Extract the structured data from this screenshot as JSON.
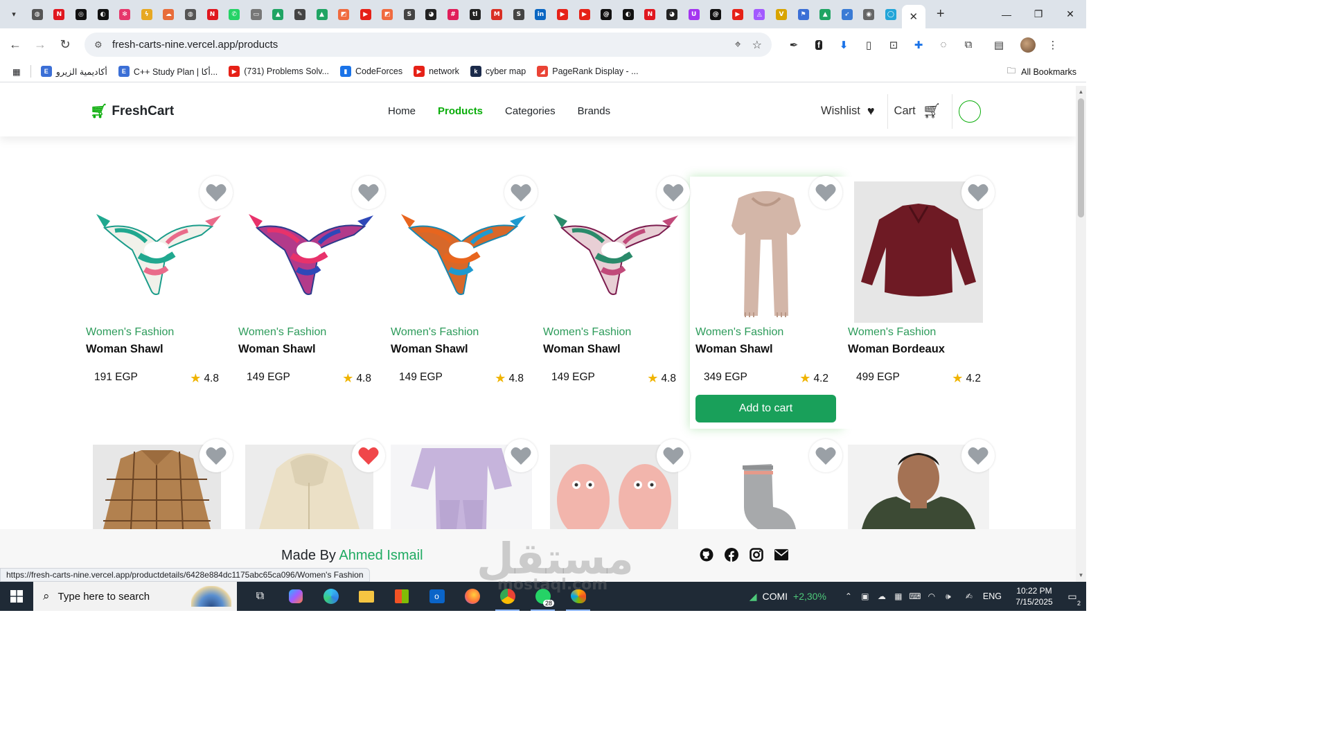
{
  "browser": {
    "tab_search_icon": "chevron-down-icon",
    "active_tab_close": "✕",
    "new_tab": "+",
    "pinned_tabs": [
      {
        "icon": "globe",
        "color": "#555",
        "glyph": "◍"
      },
      {
        "icon": "notion",
        "color": "#e0171f",
        "glyph": "N"
      },
      {
        "icon": "openai",
        "color": "#111",
        "glyph": "◎"
      },
      {
        "icon": "dev",
        "color": "#111",
        "glyph": "◐"
      },
      {
        "icon": "dribbble",
        "color": "#e6376b",
        "glyph": "✻"
      },
      {
        "icon": "bolt",
        "color": "#e7a822",
        "glyph": "ϟ"
      },
      {
        "icon": "cloud",
        "color": "#e86c3a",
        "glyph": "☁"
      },
      {
        "icon": "globe2",
        "color": "#555",
        "glyph": "◍"
      },
      {
        "icon": "notion2",
        "color": "#e0171f",
        "glyph": "N"
      },
      {
        "icon": "whatsapp",
        "color": "#25d366",
        "glyph": "✆"
      },
      {
        "icon": "slides",
        "color": "#777",
        "glyph": "▭"
      },
      {
        "icon": "drive",
        "color": "#1fa463",
        "glyph": "▲"
      },
      {
        "icon": "edit",
        "color": "#444",
        "glyph": "✎"
      },
      {
        "icon": "drive2",
        "color": "#1fa463",
        "glyph": "▲"
      },
      {
        "icon": "canva",
        "color": "#f06b3f",
        "glyph": "◩"
      },
      {
        "icon": "youtube",
        "color": "#e62117",
        "glyph": "▶"
      },
      {
        "icon": "canva2",
        "color": "#f06b3f",
        "glyph": "◩"
      },
      {
        "icon": "sheets",
        "color": "#444",
        "glyph": "S"
      },
      {
        "icon": "github",
        "color": "#222",
        "glyph": "◕"
      },
      {
        "icon": "slack",
        "color": "#e01e5a",
        "glyph": "#"
      },
      {
        "icon": "tldv",
        "color": "#222",
        "glyph": "tl"
      },
      {
        "icon": "gmail",
        "color": "#d93025",
        "glyph": "M"
      },
      {
        "icon": "sheets2",
        "color": "#444",
        "glyph": "S"
      },
      {
        "icon": "linkedin",
        "color": "#0a66c2",
        "glyph": "in"
      },
      {
        "icon": "youtube2",
        "color": "#e62117",
        "glyph": "▶"
      },
      {
        "icon": "youtube3",
        "color": "#e62117",
        "glyph": "▶"
      },
      {
        "icon": "threads",
        "color": "#111",
        "glyph": "@"
      },
      {
        "icon": "dev2",
        "color": "#111",
        "glyph": "◐"
      },
      {
        "icon": "notion3",
        "color": "#e0171f",
        "glyph": "N"
      },
      {
        "icon": "github2",
        "color": "#222",
        "glyph": "◕"
      },
      {
        "icon": "udemy",
        "color": "#a435f0",
        "glyph": "U"
      },
      {
        "icon": "threads2",
        "color": "#111",
        "glyph": "@"
      },
      {
        "icon": "youtube4",
        "color": "#e62117",
        "glyph": "▶"
      },
      {
        "icon": "figma",
        "color": "#a259ff",
        "glyph": "◬"
      },
      {
        "icon": "vue",
        "color": "#d8a400",
        "glyph": "V"
      },
      {
        "icon": "flag",
        "color": "#3b6fd6",
        "glyph": "⚑"
      },
      {
        "icon": "drive3",
        "color": "#1fa463",
        "glyph": "▲"
      },
      {
        "icon": "bird",
        "color": "#3a7bd5",
        "glyph": "➶"
      },
      {
        "icon": "photo",
        "color": "#666",
        "glyph": "◉"
      },
      {
        "icon": "circle",
        "color": "#23a5d8",
        "glyph": "◯"
      }
    ],
    "window": {
      "minimize": "—",
      "restore": "❐",
      "close": "✕"
    },
    "url": "fresh-carts-nine.vercel.app/products",
    "bookmarks": [
      {
        "label": "أكاديمية الزيرو",
        "icon": "E",
        "color": "#3b6fd6"
      },
      {
        "label": "C++ Study Plan | أكا...",
        "icon": "E",
        "color": "#3b6fd6"
      },
      {
        "label": "(731) Problems Solv...",
        "icon": "▶",
        "color": "#e62117"
      },
      {
        "label": "CodeForces",
        "icon": "▮",
        "color": "#1a73e8"
      },
      {
        "label": "network",
        "icon": "▶",
        "color": "#e62117"
      },
      {
        "label": "cyber map",
        "icon": "k",
        "color": "#1b2a4a"
      },
      {
        "label": "PageRank Display - ...",
        "icon": "◢",
        "color": "#ea4335"
      }
    ],
    "all_bookmarks": "All Bookmarks",
    "status_url": "https://fresh-carts-nine.vercel.app/productdetails/6428e884dc1175abc65ca096/Women's Fashion"
  },
  "site": {
    "brand": "FreshCart",
    "nav": [
      "Home",
      "Products",
      "Categories",
      "Brands"
    ],
    "active_nav": "Products",
    "wishlist": "Wishlist",
    "cart": "Cart",
    "accent": "#0aad0a"
  },
  "products": [
    {
      "category": "Women's Fashion",
      "title": "Woman Shawl",
      "price": "191 EGP",
      "rating": "4.8",
      "wished": false,
      "art": "scarf-teal"
    },
    {
      "category": "Women's Fashion",
      "title": "Woman Shawl",
      "price": "149 EGP",
      "rating": "4.8",
      "wished": false,
      "art": "scarf-pink"
    },
    {
      "category": "Women's Fashion",
      "title": "Woman Shawl",
      "price": "149 EGP",
      "rating": "4.8",
      "wished": false,
      "art": "scarf-orange"
    },
    {
      "category": "Women's Fashion",
      "title": "Woman Shawl",
      "price": "149 EGP",
      "rating": "4.8",
      "wished": false,
      "art": "scarf-purple"
    },
    {
      "category": "Women's Fashion",
      "title": "Woman Shawl",
      "price": "349 EGP",
      "rating": "4.2",
      "wished": false,
      "art": "scarf-beige",
      "hovered": true,
      "add_to_cart": "Add to cart"
    },
    {
      "category": "Women's Fashion",
      "title": "Woman Bordeaux",
      "price": "499 EGP",
      "rating": "4.2",
      "wished": false,
      "art": "shirt-bordeaux"
    }
  ],
  "products_row2": [
    {
      "art": "plaid-jacket",
      "wished": false
    },
    {
      "art": "hoodie-beige",
      "wished": true
    },
    {
      "art": "lilac-set",
      "wished": false
    },
    {
      "art": "pink-slippers",
      "wished": false
    },
    {
      "art": "grey-sock",
      "wished": false
    },
    {
      "art": "man-tshirt",
      "wished": false
    }
  ],
  "footer": {
    "made_by": "Made By",
    "author": "Ahmed Ismail",
    "social": [
      "github-icon",
      "facebook-icon",
      "instagram-icon",
      "mail-icon"
    ]
  },
  "watermark": {
    "arabic": "مستقل",
    "latin": "mostaql.com"
  },
  "taskbar": {
    "search_placeholder": "Type here to search",
    "stock_name": "COMI",
    "stock_change": "+2,30%",
    "lang": "ENG",
    "time": "10:22 PM",
    "date": "7/15/2025",
    "whatsapp_badge": "28",
    "notif_count": "2"
  }
}
